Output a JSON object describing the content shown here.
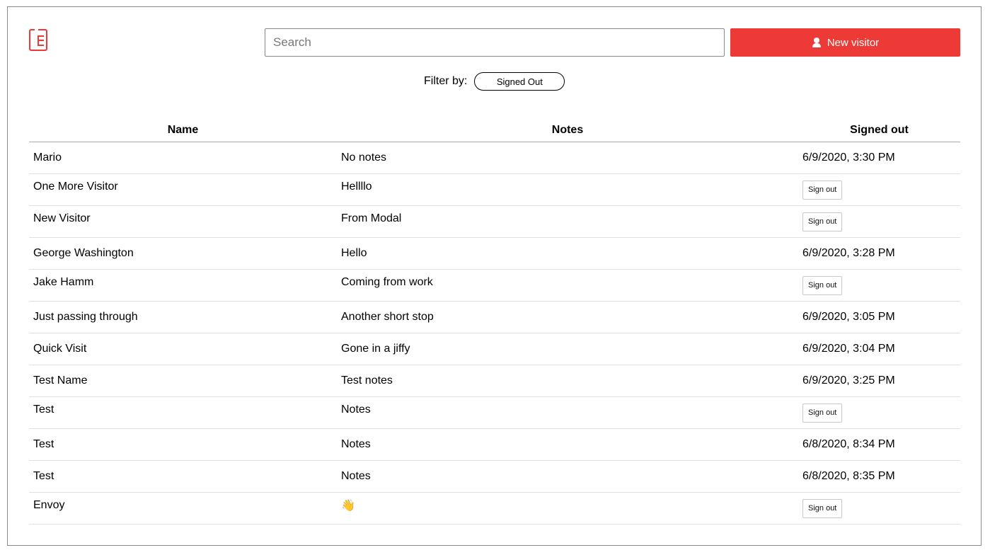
{
  "search": {
    "placeholder": "Search"
  },
  "new_visitor": {
    "label": "New visitor",
    "icon": "user-icon",
    "color": "#ee3a36"
  },
  "filter": {
    "label": "Filter by:",
    "selected": "Signed Out"
  },
  "table": {
    "headers": [
      "Name",
      "Notes",
      "Signed out"
    ],
    "signout_label": "Sign out",
    "rows": [
      {
        "name": "Mario",
        "notes": "No notes",
        "signed_out": "6/9/2020, 3:30 PM"
      },
      {
        "name": "One More Visitor",
        "notes": "Hellllo",
        "signed_out": ""
      },
      {
        "name": "New Visitor",
        "notes": "From Modal",
        "signed_out": ""
      },
      {
        "name": "George Washington",
        "notes": "Hello",
        "signed_out": "6/9/2020, 3:28 PM"
      },
      {
        "name": "Jake Hamm",
        "notes": "Coming from work",
        "signed_out": ""
      },
      {
        "name": "Just passing through",
        "notes": "Another short stop",
        "signed_out": "6/9/2020, 3:05 PM"
      },
      {
        "name": "Quick Visit",
        "notes": "Gone in a jiffy",
        "signed_out": "6/9/2020, 3:04 PM"
      },
      {
        "name": "Test Name",
        "notes": "Test notes",
        "signed_out": "6/9/2020, 3:25 PM"
      },
      {
        "name": "Test",
        "notes": "Notes",
        "signed_out": ""
      },
      {
        "name": "Test",
        "notes": "Notes",
        "signed_out": "6/8/2020, 8:34 PM"
      },
      {
        "name": "Test",
        "notes": "Notes",
        "signed_out": "6/8/2020, 8:35 PM"
      },
      {
        "name": "Envoy",
        "notes": "👋",
        "signed_out": ""
      }
    ]
  }
}
